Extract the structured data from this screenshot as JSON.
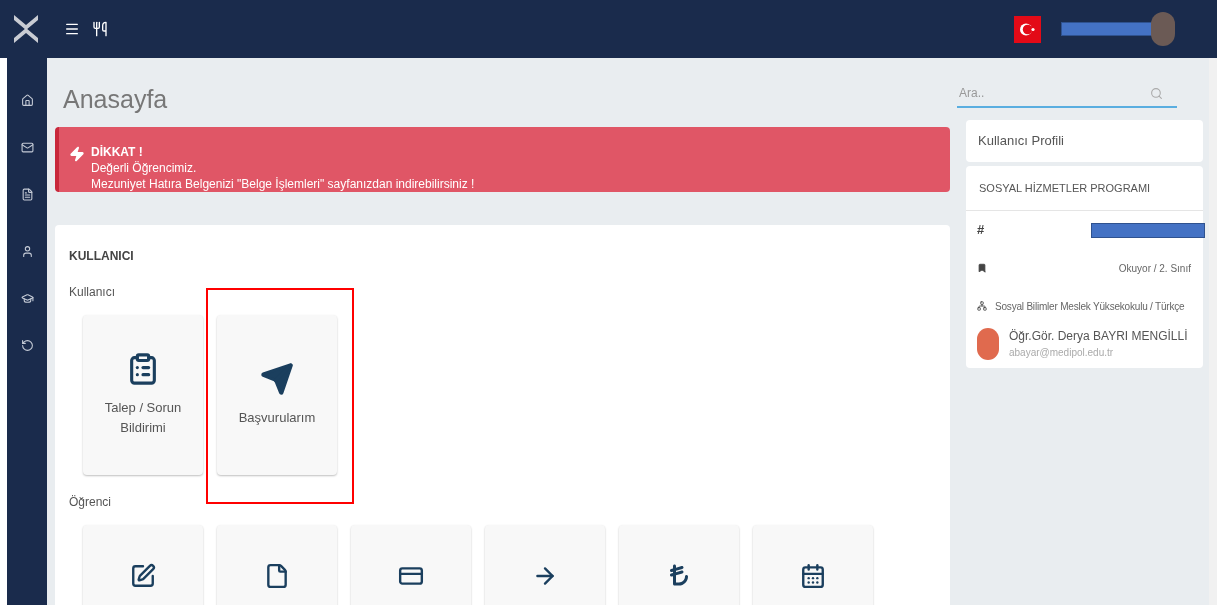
{
  "topbar": {
    "user_redacted": true
  },
  "sidebar": {
    "items": [
      {
        "kind": "home"
      },
      {
        "kind": "mail"
      },
      {
        "kind": "document"
      },
      {
        "kind": "user"
      },
      {
        "kind": "graduation"
      },
      {
        "kind": "history"
      }
    ]
  },
  "page_title": "Anasayfa",
  "alert": {
    "title": "DİKKAT !",
    "lines": [
      "Değerli Öğrencimiz.",
      "Mezuniyet Hatıra Belgenizi \"Belge İşlemleri\" sayfanızdan indirebilirsiniz !"
    ]
  },
  "panel": {
    "title": "KULLANICI",
    "sections": [
      {
        "label": "Kullanıcı",
        "tiles": [
          {
            "kind": "request",
            "label": "Talep / Sorun Bildirimi",
            "highlighted": false
          },
          {
            "kind": "send",
            "label": "Başvurularım",
            "highlighted": true
          }
        ]
      },
      {
        "label": "Öğrenci",
        "tiles": [
          {
            "kind": "edit",
            "highlighted": false
          },
          {
            "kind": "file",
            "highlighted": false
          },
          {
            "kind": "card",
            "highlighted": false
          },
          {
            "kind": "arrow",
            "highlighted": false
          },
          {
            "kind": "lira",
            "highlighted": false
          },
          {
            "kind": "calendar",
            "highlighted": false
          }
        ]
      }
    ]
  },
  "search": {
    "placeholder": "Ara.."
  },
  "profile": {
    "title": "Kullanıcı Profili",
    "program": "SOSYAL HİZMETLER PROGRAMI",
    "rows": [
      {
        "kind": "id",
        "symbol": "#",
        "redacted": true
      },
      {
        "kind": "status",
        "text": "Okuyor / 2. Sınıf"
      },
      {
        "kind": "faculty",
        "text": "Sosyal Bilimler Meslek Yüksekokulu / Türkçe"
      }
    ],
    "advisor": {
      "name": "Öğr.Gör. Derya BAYRI MENGİLLİ",
      "email": "abayar@medipol.edu.tr"
    }
  }
}
